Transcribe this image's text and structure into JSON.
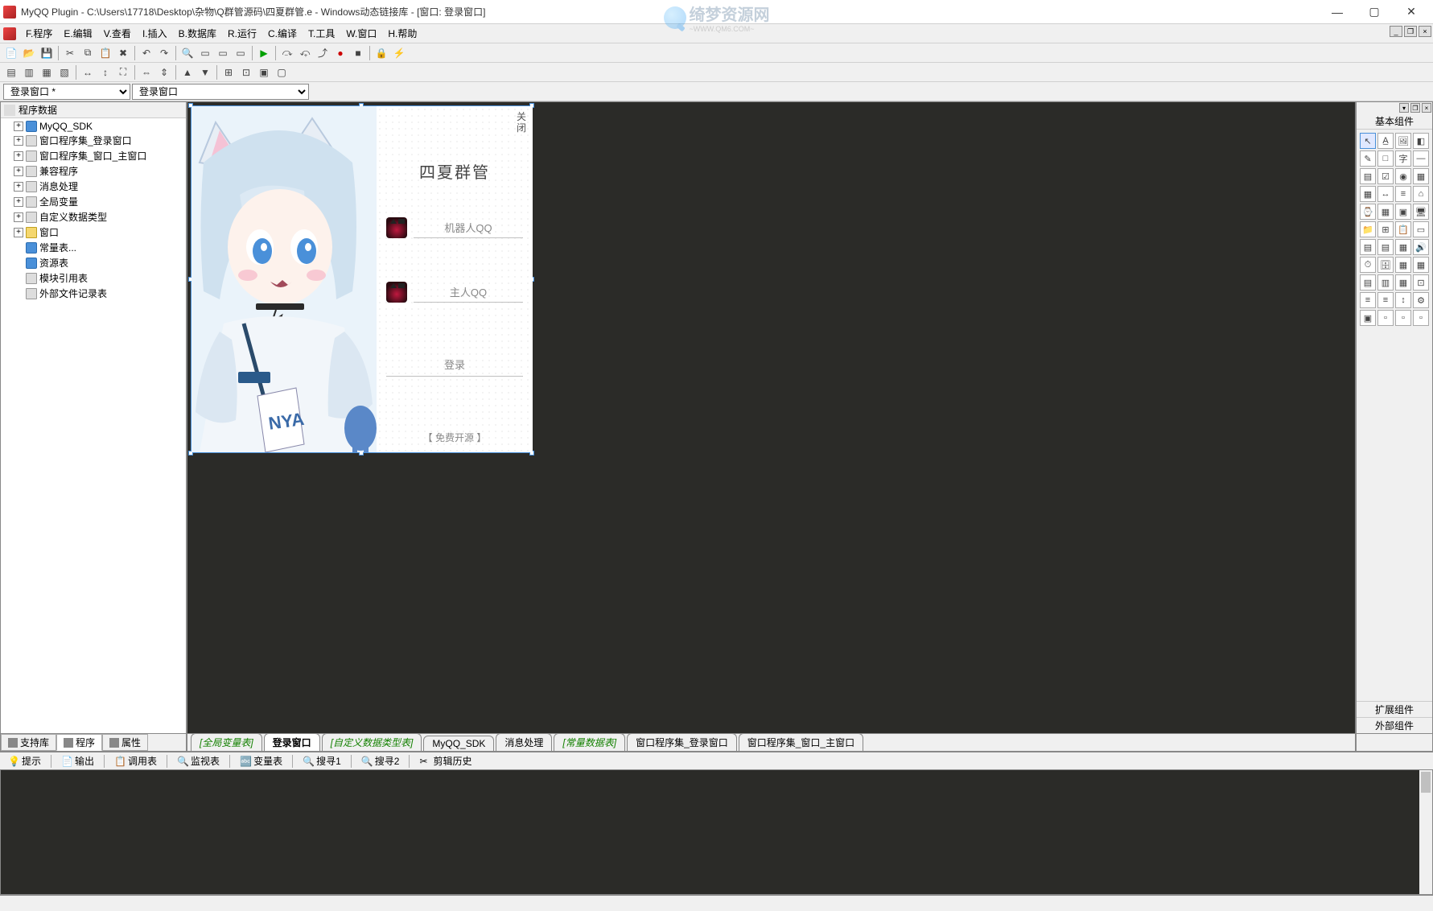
{
  "titlebar": {
    "text": "MyQQ Plugin - C:\\Users\\17718\\Desktop\\杂物\\Q群管源码\\四夏群管.e - Windows动态链接库 - [窗口: 登录窗口]"
  },
  "watermark": {
    "text": "绮梦资源网",
    "sub": "~WWW.QM6.COM~"
  },
  "menu": {
    "items": [
      "F.程序",
      "E.编辑",
      "V.查看",
      "I.插入",
      "B.数据库",
      "R.运行",
      "C.编译",
      "T.工具",
      "W.窗口",
      "H.帮助"
    ]
  },
  "combo": {
    "left": "登录窗口 *",
    "right": "登录窗口"
  },
  "tree": {
    "title": "程序数据",
    "items": [
      {
        "label": "MyQQ_SDK",
        "toggle": "+",
        "icon": "db"
      },
      {
        "label": "窗口程序集_登录窗口",
        "toggle": "+",
        "icon": "mod"
      },
      {
        "label": "窗口程序集_窗口_主窗口",
        "toggle": "+",
        "icon": "mod"
      },
      {
        "label": "兼容程序",
        "toggle": "+",
        "icon": "mod"
      },
      {
        "label": "消息处理",
        "toggle": "+",
        "icon": "mod"
      },
      {
        "label": "全局变量",
        "toggle": "+",
        "icon": "mod"
      },
      {
        "label": "自定义数据类型",
        "toggle": "+",
        "icon": "mod"
      },
      {
        "label": "窗口",
        "toggle": "+",
        "icon": "folder"
      },
      {
        "label": "常量表...",
        "toggle": "",
        "icon": "db"
      },
      {
        "label": "资源表",
        "toggle": "",
        "icon": "db"
      },
      {
        "label": "模块引用表",
        "toggle": "",
        "icon": "mod"
      },
      {
        "label": "外部文件记录表",
        "toggle": "",
        "icon": "mod"
      }
    ]
  },
  "leftTabs": {
    "items": [
      "支持库",
      "程序",
      "属性"
    ],
    "active": 1
  },
  "form": {
    "cornerText": "关\n闭",
    "title": "四夏群管",
    "field1": "机器人QQ",
    "field2": "主人QQ",
    "loginBtn": "登录",
    "footer": "【 免费开源 】"
  },
  "centerTabs": {
    "items": [
      {
        "label": "[全局变量表]",
        "style": "italic"
      },
      {
        "label": "登录窗口",
        "style": "active"
      },
      {
        "label": "[自定义数据类型表]",
        "style": "italic"
      },
      {
        "label": "MyQQ_SDK",
        "style": "plain"
      },
      {
        "label": "消息处理",
        "style": "plain"
      },
      {
        "label": "[常量数据表]",
        "style": "italic"
      },
      {
        "label": "窗口程序集_登录窗口",
        "style": "plain"
      },
      {
        "label": "窗口程序集_窗口_主窗口",
        "style": "plain"
      }
    ]
  },
  "rightPanel": {
    "title": "基本组件",
    "footer1": "扩展组件",
    "footer2": "外部组件"
  },
  "outputTabs": {
    "items": [
      "提示",
      "输出",
      "调用表",
      "监视表",
      "变量表",
      "搜寻1",
      "搜寻2",
      "剪辑历史"
    ]
  },
  "statusbar": {
    "text": ""
  }
}
